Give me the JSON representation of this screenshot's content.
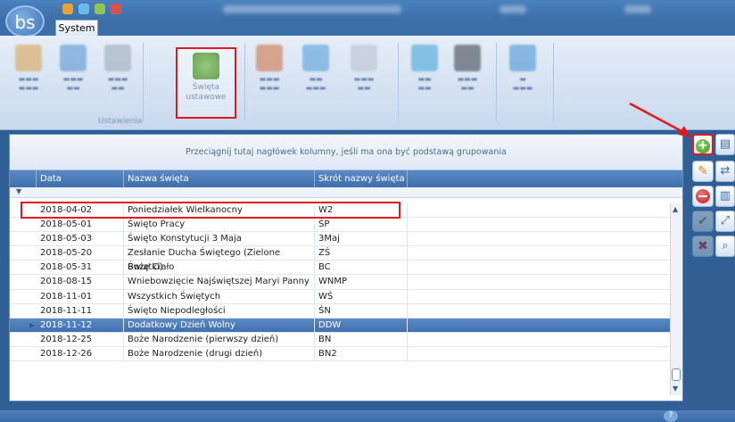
{
  "app": {
    "logo_text": "bs",
    "menu_tab": "System"
  },
  "ribbon": {
    "highlighted_button": {
      "line1": "Święta",
      "line2": "ustawowe"
    },
    "group_label": "Ustawienia"
  },
  "grid": {
    "group_hint": "Przeciągnij tutaj nagłówek kolumny, jeśli ma ona być podstawą grupowania",
    "columns": [
      "Data",
      "Nazwa święta",
      "Skrót nazwy święta"
    ],
    "filter_icon": "filter-icon",
    "rows": [
      {
        "date": "2018-04-02",
        "name": "Poniedziałek Wielkanocny",
        "short": "W2",
        "selected": false
      },
      {
        "date": "2018-05-01",
        "name": "Święto Pracy",
        "short": "ŚP",
        "selected": false
      },
      {
        "date": "2018-05-03",
        "name": "Święto Konstytucji 3 Maja",
        "short": "3Maj",
        "selected": false
      },
      {
        "date": "2018-05-20",
        "name": "Zesłanie Ducha Świętego (Zielone Świątki)",
        "short": "ZŚ",
        "selected": false
      },
      {
        "date": "2018-05-31",
        "name": "Boże Ciało",
        "short": "BC",
        "selected": false
      },
      {
        "date": "2018-08-15",
        "name": "Wniebowzięcie Najświętszej Maryi Panny",
        "short": "WNMP",
        "selected": false
      },
      {
        "date": "2018-11-01",
        "name": "Wszystkich Świętych",
        "short": "WŚ",
        "selected": false
      },
      {
        "date": "2018-11-11",
        "name": "Święto Niepodległości",
        "short": "ŚN",
        "selected": false
      },
      {
        "date": "2018-11-12",
        "name": "Dodatkowy Dzień Wolny",
        "short": "DDW",
        "selected": true
      },
      {
        "date": "2018-12-25",
        "name": "Boże Narodzenie (pierwszy dzień)",
        "short": "BN",
        "selected": false
      },
      {
        "date": "2018-12-26",
        "name": "Boże Narodzenie (drugi dzień)",
        "short": "BN2",
        "selected": false
      }
    ]
  },
  "side_tools": {
    "add": "plus-icon",
    "edit": "pencil-icon",
    "delete": "minus-icon",
    "confirm": "check-icon",
    "cancel": "x-icon"
  },
  "colors": {
    "accent": "#3a6ea6",
    "highlight_border": "#e0191f",
    "selected_row": "#4a7bb8"
  }
}
